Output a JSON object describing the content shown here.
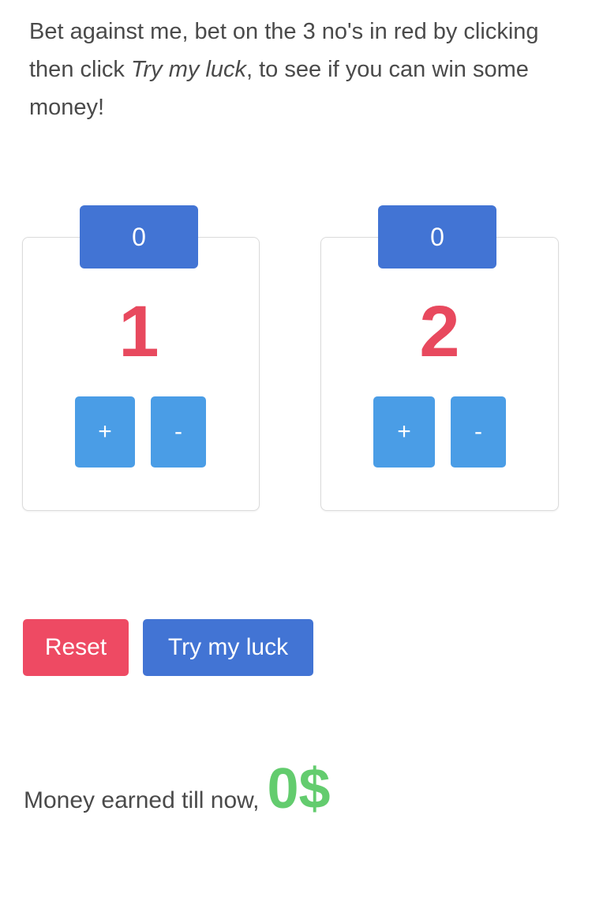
{
  "intro": {
    "line1": "Bet against me, bet on the 3 no's in red by clicking",
    "line2_before": "then click ",
    "line2_emphasis": "Try my luck",
    "line2_after": ", to see if you can win some",
    "line3": "money!"
  },
  "cards": [
    {
      "bet_count": "0",
      "number": "1",
      "plus_label": "+",
      "minus_label": "-"
    },
    {
      "bet_count": "0",
      "number": "2",
      "plus_label": "+",
      "minus_label": "-"
    }
  ],
  "actions": {
    "reset_label": "Reset",
    "try_label": "Try my luck"
  },
  "money": {
    "label": "Money earned till now,",
    "value": "0$"
  },
  "colors": {
    "primary": "#4274d4",
    "info": "#4a9de6",
    "danger": "#ee4a63",
    "number_red": "#e8495e",
    "success": "#63cc6e",
    "text": "#4a4a4a"
  }
}
